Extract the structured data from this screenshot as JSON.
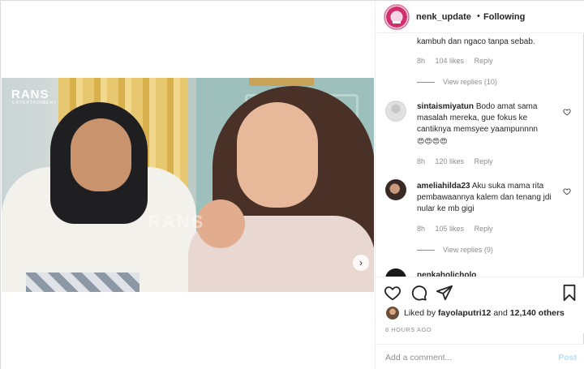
{
  "header": {
    "username": "nenk_update",
    "separator": "•",
    "follow_label": "Following"
  },
  "video": {
    "logo": "RANS",
    "logo_sub": "ENTERTAINMENT",
    "watermark": "RANS",
    "next_icon": "chevron-right-icon"
  },
  "comments": [
    {
      "text_tail": "kambuh dan ngaco tanpa sebab.",
      "time": "8h",
      "likes": "104 likes",
      "reply": "Reply",
      "view_replies": "View replies (10)"
    },
    {
      "username": "sintaismiyatun",
      "text": "Bodo amat sama masalah mereka, gue fokus ke cantiknya memsyee yaampunnnn",
      "emoji": "😍😍😍😍",
      "time": "8h",
      "likes": "120 likes",
      "reply": "Reply"
    },
    {
      "username": "ameliahilda23",
      "text": "Aku suka mama rita pembawaannya kalem dan tenang jdi nular ke mb gigi",
      "time": "8h",
      "likes": "105 likes",
      "reply": "Reply",
      "view_replies": "View replies (9)"
    },
    {
      "username": "nenkaholicholo"
    }
  ],
  "actions": {
    "liked_by_prefix": "Liked by",
    "liked_by_user": "fayolaputri12",
    "and_label": "and",
    "others": "12,140 others",
    "timestamp": "8 HOURS AGO"
  },
  "add_comment": {
    "placeholder": "Add a comment...",
    "post_label": "Post"
  }
}
